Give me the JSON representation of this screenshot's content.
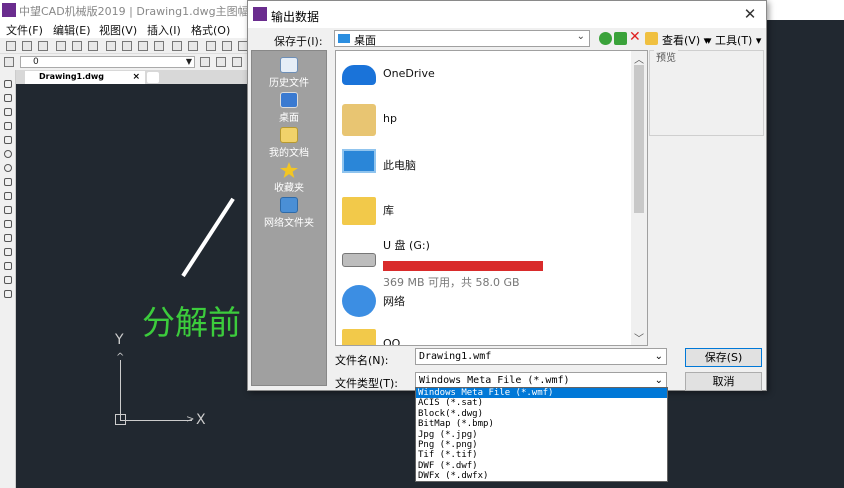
{
  "app": {
    "title": "中望CAD机械版2019 | Drawing1.dwg主图幅",
    "menu": [
      "文件(F)",
      "编辑(E)",
      "视图(V)",
      "插入(I)",
      "格式(O)"
    ],
    "layer_value": "0",
    "doc_tab": "Drawing1.dwg",
    "doc_tab_close": "×",
    "canvas_text": "分解前",
    "ucs_x": "X",
    "ucs_y": "Y"
  },
  "dialog": {
    "title": "输出数据",
    "close": "✕",
    "save_in_label": "保存于(I):",
    "save_in_value": "桌面",
    "view_label": "查看(V)",
    "tools_label": "工具(T)",
    "preview_label": "预览",
    "places": [
      {
        "label": "历史文件",
        "icon": "history-icon"
      },
      {
        "label": "桌面",
        "icon": "desktop-icon"
      },
      {
        "label": "我的文档",
        "icon": "documents-icon"
      },
      {
        "label": "收藏夹",
        "icon": "favorites-icon"
      },
      {
        "label": "网络文件夹",
        "icon": "network-folder-icon"
      }
    ],
    "files": [
      {
        "name": "OneDrive",
        "icon": "onedrive-icon"
      },
      {
        "name": "hp",
        "icon": "user-folder-icon"
      },
      {
        "name": "此电脑",
        "icon": "computer-icon"
      },
      {
        "name": "库",
        "icon": "library-icon"
      },
      {
        "name": "U 盘 (G:)",
        "icon": "usb-drive-icon",
        "info": "369 MB 可用，共 58.0 GB"
      },
      {
        "name": "网络",
        "icon": "network-icon"
      },
      {
        "name": "QQ",
        "icon": "folder-icon"
      }
    ],
    "filename_label": "文件名(N):",
    "filename_value": "Drawing1.wmf",
    "filetype_label": "文件类型(T):",
    "filetype_value": "Windows Meta File (*.wmf)",
    "save_label": "保存(S)",
    "cancel_label": "取消",
    "filetype_options": [
      "Windows Meta File (*.wmf)",
      "ACIS (*.sat)",
      "Block(*.dwg)",
      "BitMap (*.bmp)",
      "Jpg (*.jpg)",
      "Png (*.png)",
      "Tif (*.tif)",
      "DWF (*.dwf)",
      "DWFx (*.dwfx)"
    ]
  }
}
